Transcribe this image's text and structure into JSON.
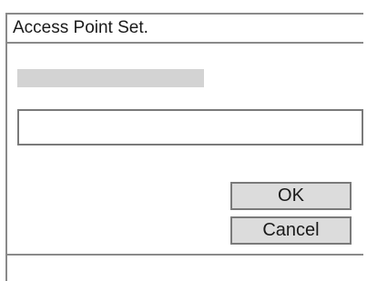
{
  "dialog": {
    "title": "Access Point Set.",
    "field_value": "",
    "ok_label": "OK",
    "cancel_label": "Cancel"
  }
}
